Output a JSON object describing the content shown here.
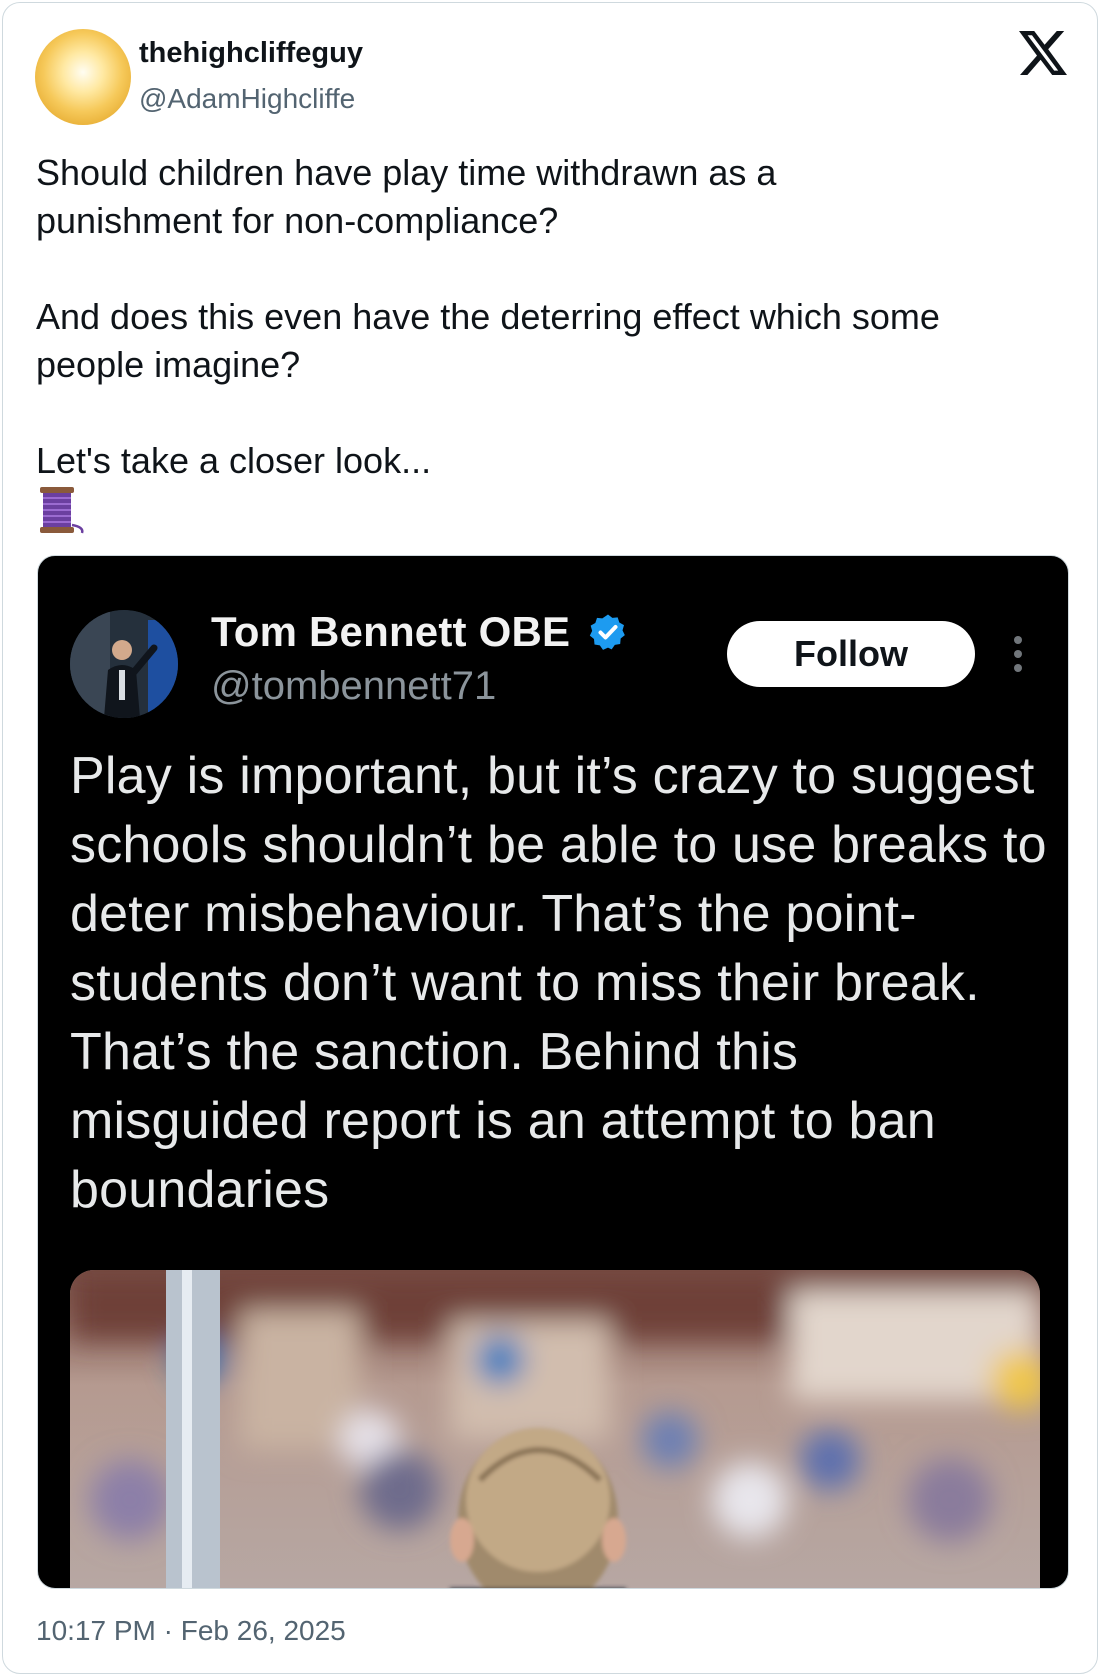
{
  "author": {
    "display_name": "thehighcliffeguy",
    "handle": "@AdamHighcliffe"
  },
  "platform_icon": "x-logo-icon",
  "tweet": {
    "text": "Should children have play time withdrawn as a\npunishment for non-compliance?\n\nAnd does this even have the deterring effect which some\npeople imagine?\n\nLet's take a closer look...",
    "emoji_icon": "thread-spool-icon"
  },
  "quoted_screenshot": {
    "display_name": "Tom Bennett OBE",
    "handle": "@tombennett71",
    "verified": true,
    "follow_label": "Follow",
    "text": "Play is important, but it’s crazy to suggest schools shouldn’t be able to use breaks to deter misbehaviour. That’s the point- students don’t want to miss their break. That’s the sanction. Behind this misguided report is an attempt to ban boundaries"
  },
  "timestamp": "10:17 PM · Feb 26, 2025",
  "colors": {
    "accent_verified": "#1d9bf0",
    "text_secondary": "#536471"
  }
}
